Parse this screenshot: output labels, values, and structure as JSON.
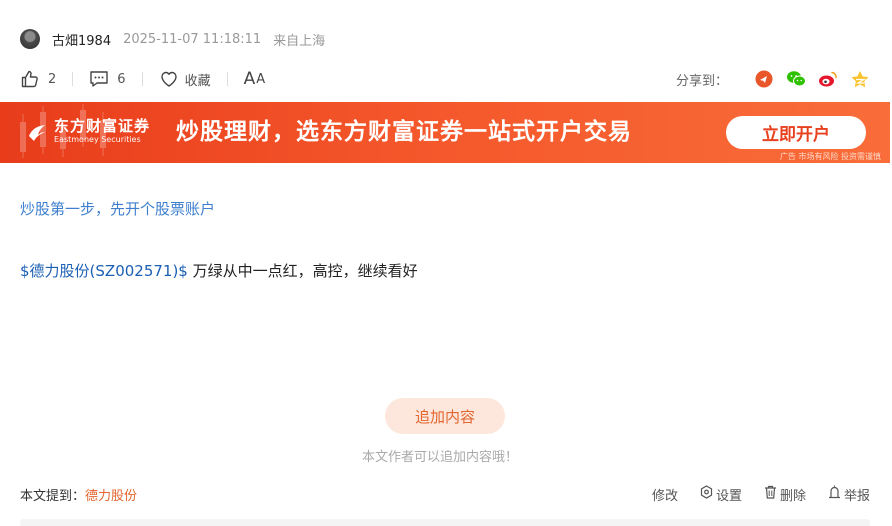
{
  "author": {
    "name": "古畑1984",
    "time": "2025-11-07 11:18:11",
    "from": "来自上海"
  },
  "actions": {
    "like_count": "2",
    "comment_count": "6",
    "favorite_label": "收藏",
    "font_size_big": "A",
    "font_size_small": "A",
    "share_label": "分享到："
  },
  "banner": {
    "brand_cn": "东方财富证券",
    "brand_en": "Eastmoney Securities",
    "slogan": "炒股理财，选东方财富证券一站式开户交易",
    "cta": "立即开户",
    "note": "广告 市场有风险 投资需谨慎"
  },
  "content": {
    "tip_link": "炒股第一步，先开个股票账户",
    "stock_link": "$德力股份(SZ002571)$",
    "text": " 万绿从中一点红，高控，继续看好"
  },
  "append": {
    "button": "追加内容",
    "hint": "本文作者可以追加内容哦！"
  },
  "footer": {
    "mention_label": "本文提到：",
    "mention_stock": "德力股份",
    "edit": "修改",
    "settings": "设置",
    "delete": "删除",
    "report": "举报"
  },
  "colors": {
    "link_blue": "#3e7fce",
    "stock_blue": "#1a5fb4",
    "accent_orange": "#e2662e",
    "banner_red": "#e83c1b"
  },
  "icons": {
    "like": "thumbs-up-icon",
    "comment": "comment-icon",
    "favorite": "heart-icon",
    "share": [
      "toutiao-icon",
      "wechat-icon",
      "weibo-icon",
      "qq-zone-icon"
    ],
    "settings": "hexagon-gear-icon",
    "delete": "trash-icon",
    "report": "report-icon"
  }
}
